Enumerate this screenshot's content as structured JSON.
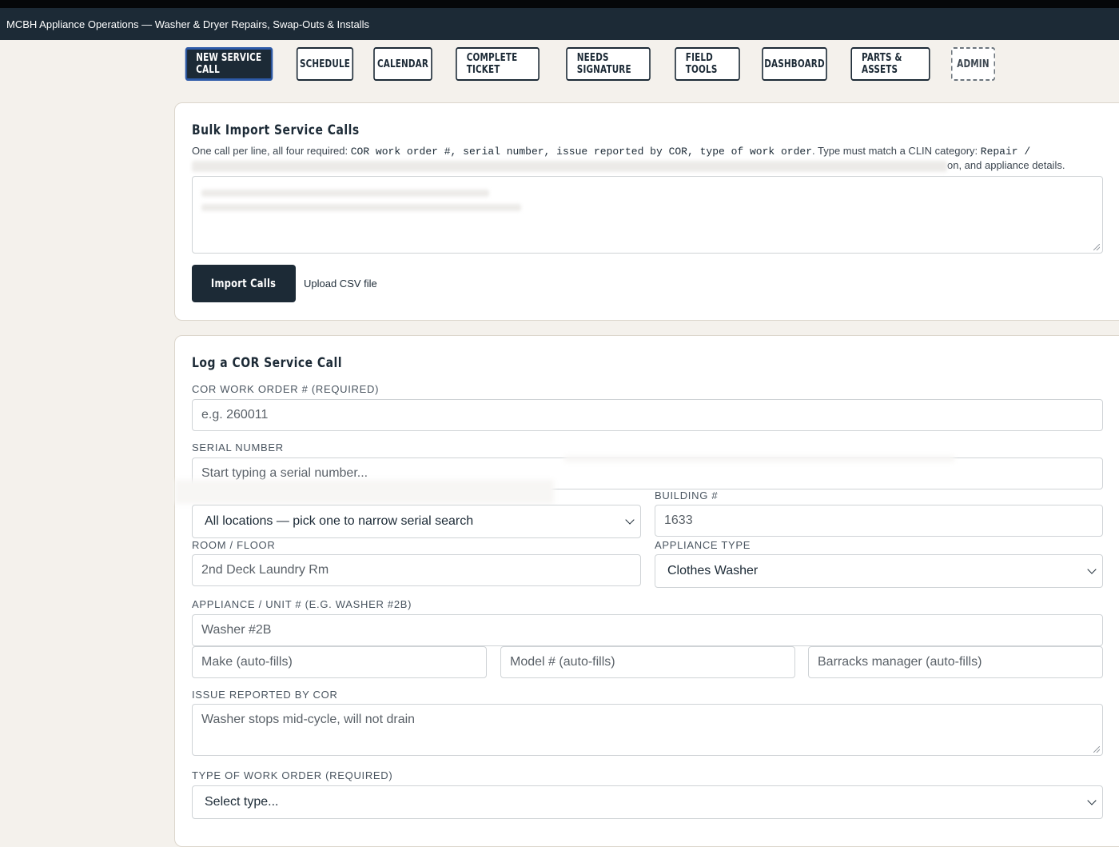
{
  "app": {
    "title": "MCBH Appliance Operations — Washer & Dryer Repairs, Swap-Outs & Installs"
  },
  "nav": {
    "tabs": [
      {
        "label": "New Service Call",
        "active": true
      },
      {
        "label": "Schedule"
      },
      {
        "label": "Calendar"
      },
      {
        "label": "Complete Ticket"
      },
      {
        "label": "Needs Signature"
      },
      {
        "label": "Field Tools"
      },
      {
        "label": "Dashboard"
      },
      {
        "label": "Parts & Assets"
      },
      {
        "label": "Admin",
        "dashed": true
      }
    ]
  },
  "bulk": {
    "title": "Bulk Import Service Calls",
    "help_prefix": "One call per line, all four required: ",
    "help_fields": "COR work order #, serial number, issue reported by COR, type of work order",
    "help_middle": ". Type must match a CLIN category: ",
    "help_category": "Repair /",
    "help_suffix": "on, and appliance details.",
    "import_label": "Import Calls",
    "upload_label": "Upload CSV file"
  },
  "log": {
    "title": "Log a COR Service Call",
    "work_order": {
      "label": "COR Work Order # (Required)",
      "placeholder": "e.g. 260011"
    },
    "serial": {
      "label": "Serial Number",
      "placeholder": "Start typing a serial number..."
    },
    "location": {
      "selected": "All locations — pick one to narrow serial search"
    },
    "building": {
      "label": "Building #",
      "value": "1633"
    },
    "room": {
      "label": "Room / Floor",
      "value": "2nd Deck Laundry Rm"
    },
    "appliance_type": {
      "label": "Appliance Type",
      "selected": "Clothes Washer"
    },
    "unit": {
      "label": "Appliance / Unit # (e.g. Washer #2B)",
      "value": "Washer #2B"
    },
    "make": {
      "placeholder": "Make (auto-fills)"
    },
    "model": {
      "placeholder": "Model # (auto-fills)"
    },
    "manager": {
      "placeholder": "Barracks manager (auto-fills)"
    },
    "issue": {
      "label": "Issue Reported by COR",
      "value": "Washer stops mid-cycle, will not drain"
    },
    "wo_type": {
      "label": "Type of Work Order (Required)",
      "selected": "Select type..."
    }
  },
  "colors": {
    "navy": "#1c2a36",
    "page_bg": "#f4f1ec",
    "active_border": "#2d5aa8"
  }
}
